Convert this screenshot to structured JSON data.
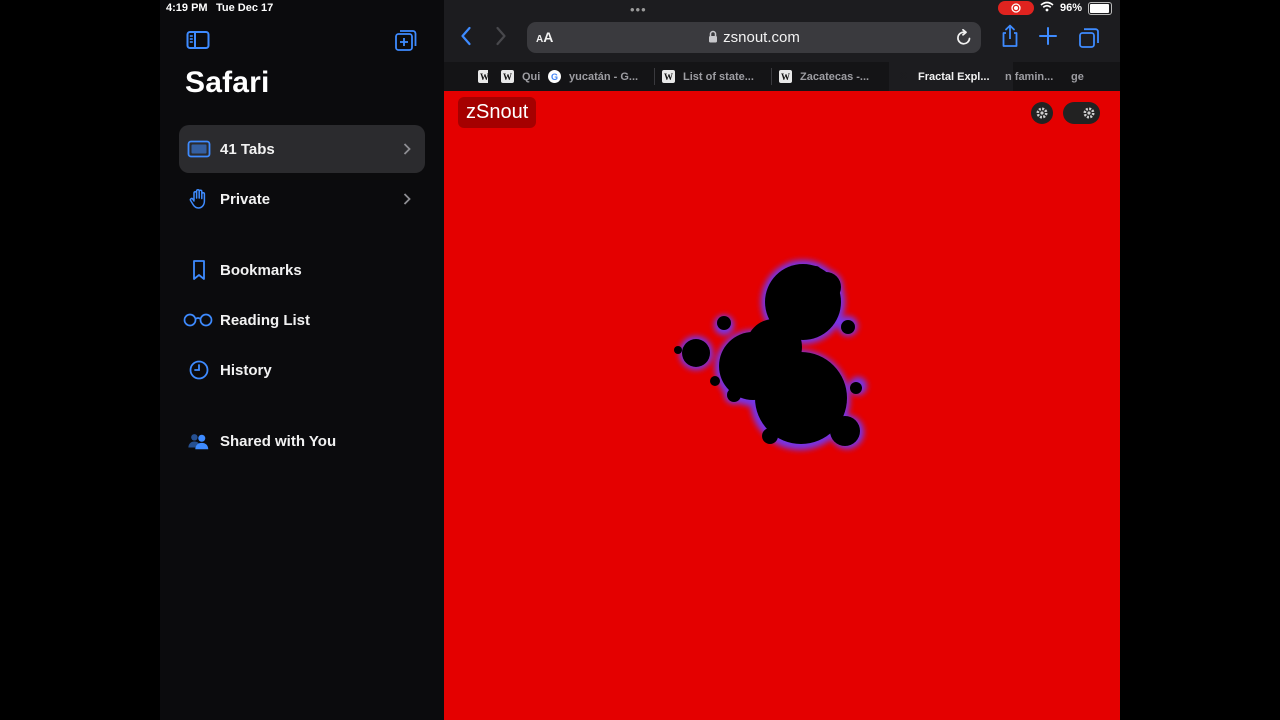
{
  "status_bar": {
    "time": "4:19 PM",
    "date": "Tue Dec 17",
    "battery": "96%",
    "battery_level": 0.96,
    "recording": true
  },
  "sidebar": {
    "title": "Safari",
    "items": [
      {
        "label": "41 Tabs",
        "icon": "tabs-icon",
        "selected": true,
        "chevron": true
      },
      {
        "label": "Private",
        "icon": "hand-icon",
        "selected": false,
        "chevron": true
      },
      {
        "label": "Bookmarks",
        "icon": "bookmark-icon",
        "selected": false,
        "chevron": false
      },
      {
        "label": "Reading List",
        "icon": "glasses-icon",
        "selected": false,
        "chevron": false
      },
      {
        "label": "History",
        "icon": "clock-icon",
        "selected": false,
        "chevron": false
      },
      {
        "label": "Shared with You",
        "icon": "people-icon",
        "selected": false,
        "chevron": false
      }
    ]
  },
  "toolbar": {
    "reader_label_big": "A",
    "reader_label_small": "A",
    "url": "zsnout.com",
    "multitask": "•••"
  },
  "tabs": [
    {
      "title": "",
      "favicon": "W"
    },
    {
      "title": "Qui",
      "favicon": "W"
    },
    {
      "title": "yucatán - G...",
      "favicon": "G"
    },
    {
      "title": "List of state...",
      "favicon": "W"
    },
    {
      "title": "Zacatecas -...",
      "favicon": "W"
    },
    {
      "title": "Fractal Expl...",
      "favicon": "✕",
      "active": true
    },
    {
      "title": "n famin...",
      "favicon": ""
    },
    {
      "title": "ge",
      "favicon": ""
    }
  ],
  "page": {
    "logo": "zSnout",
    "background_color": "#e40000"
  },
  "colors": {
    "accent": "#3e8bff",
    "sidebar_bg": "#0b0b0d",
    "selected_row": "#2b2b2e",
    "fractal_edge": "#6a3bff"
  }
}
